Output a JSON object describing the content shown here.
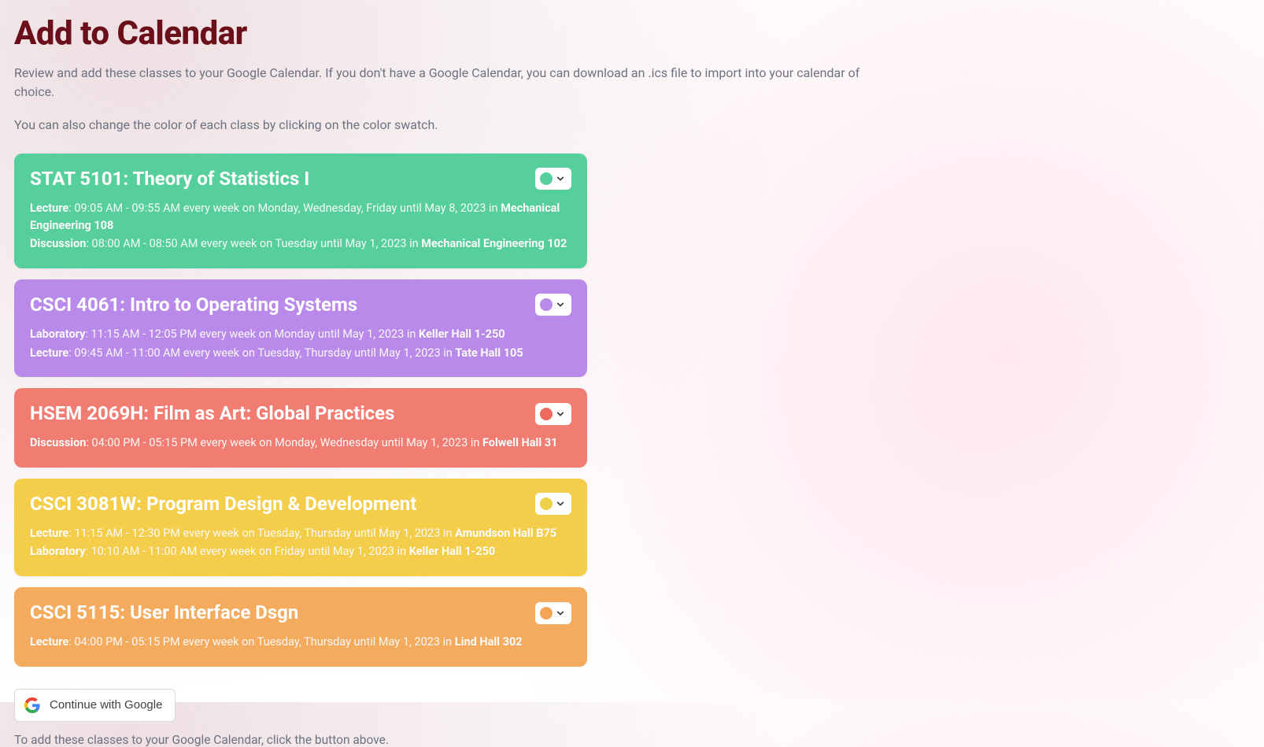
{
  "page": {
    "title": "Add to Calendar",
    "intro1": "Review and add these classes to your Google Calendar. If you don't have a Google Calendar, you can download an .ics file to import into your calendar of choice.",
    "intro2": "You can also change the color of each class by clicking on the color swatch.",
    "footnote": "To add these classes to your Google Calendar, click the button above."
  },
  "google_button_label": "Continue with Google",
  "classes": [
    {
      "title": "STAT 5101: Theory of Statistics I",
      "bg": "#57cf9c",
      "swatch": "#57cf9c",
      "sessions": [
        {
          "type": "Lecture",
          "details": ": 09:05 AM - 09:55 AM every week on Monday, Wednesday, Friday until May 8, 2023 in ",
          "location": "Mechanical Engineering 108"
        },
        {
          "type": "Discussion",
          "details": ": 08:00 AM - 08:50 AM every week on Tuesday until May 1, 2023 in ",
          "location": "Mechanical Engineering 102"
        }
      ]
    },
    {
      "title": "CSCI 4061: Intro to Operating Systems",
      "bg": "#b98ae9",
      "swatch": "#b98ae9",
      "sessions": [
        {
          "type": "Laboratory",
          "details": ": 11:15 AM - 12:05 PM every week on Monday until May 1, 2023 in ",
          "location": "Keller Hall 1-250"
        },
        {
          "type": "Lecture",
          "details": ": 09:45 AM - 11:00 AM every week on Tuesday, Thursday until May 1, 2023 in ",
          "location": "Tate Hall 105"
        }
      ]
    },
    {
      "title": "HSEM 2069H: Film as Art: Global Practices",
      "bg": "#f17d72",
      "swatch": "#ee6a5d",
      "sessions": [
        {
          "type": "Discussion",
          "details": ": 04:00 PM - 05:15 PM every week on Monday, Wednesday until May 1, 2023 in ",
          "location": "Folwell Hall 31"
        }
      ]
    },
    {
      "title": "CSCI 3081W: Program Design & Development",
      "bg": "#f4ce4b",
      "swatch": "#f0d14c",
      "sessions": [
        {
          "type": "Lecture",
          "details": ": 11:15 AM - 12:30 PM every week on Tuesday, Thursday until May 1, 2023 in ",
          "location": "Amundson Hall B75"
        },
        {
          "type": "Laboratory",
          "details": ": 10:10 AM - 11:00 AM every week on Friday until May 1, 2023 in ",
          "location": "Keller Hall 1-250"
        }
      ]
    },
    {
      "title": "CSCI 5115: User Interface Dsgn",
      "bg": "#f5ab5e",
      "swatch": "#f3a456",
      "sessions": [
        {
          "type": "Lecture",
          "details": ": 04:00 PM - 05:15 PM every week on Tuesday, Thursday until May 1, 2023 in ",
          "location": "Lind Hall 302"
        }
      ]
    }
  ]
}
